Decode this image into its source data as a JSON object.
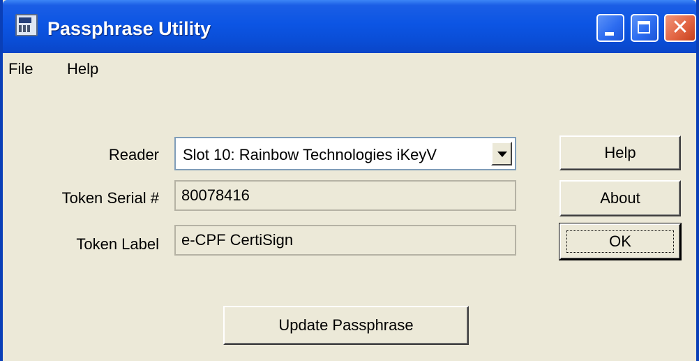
{
  "window": {
    "title": "Passphrase Utility",
    "icon": "smartcard-reader-icon",
    "caption_buttons": [
      "minimize",
      "maximize",
      "close"
    ]
  },
  "menu": {
    "file": "File",
    "help": "Help"
  },
  "form": {
    "reader_label": "Reader",
    "reader_value": "Slot 10: Rainbow Technologies iKeyV",
    "serial_label": "Token Serial #",
    "serial_value": "80078416",
    "token_label_label": "Token Label",
    "token_label_value": "e-CPF CertiSign"
  },
  "buttons": {
    "help": "Help",
    "about": "About",
    "ok": "OK",
    "update": "Update Passphrase"
  },
  "colors": {
    "titlebar": "#0a4ed7",
    "dialog_bg": "#ece9d8",
    "close_button": "#e26543"
  }
}
